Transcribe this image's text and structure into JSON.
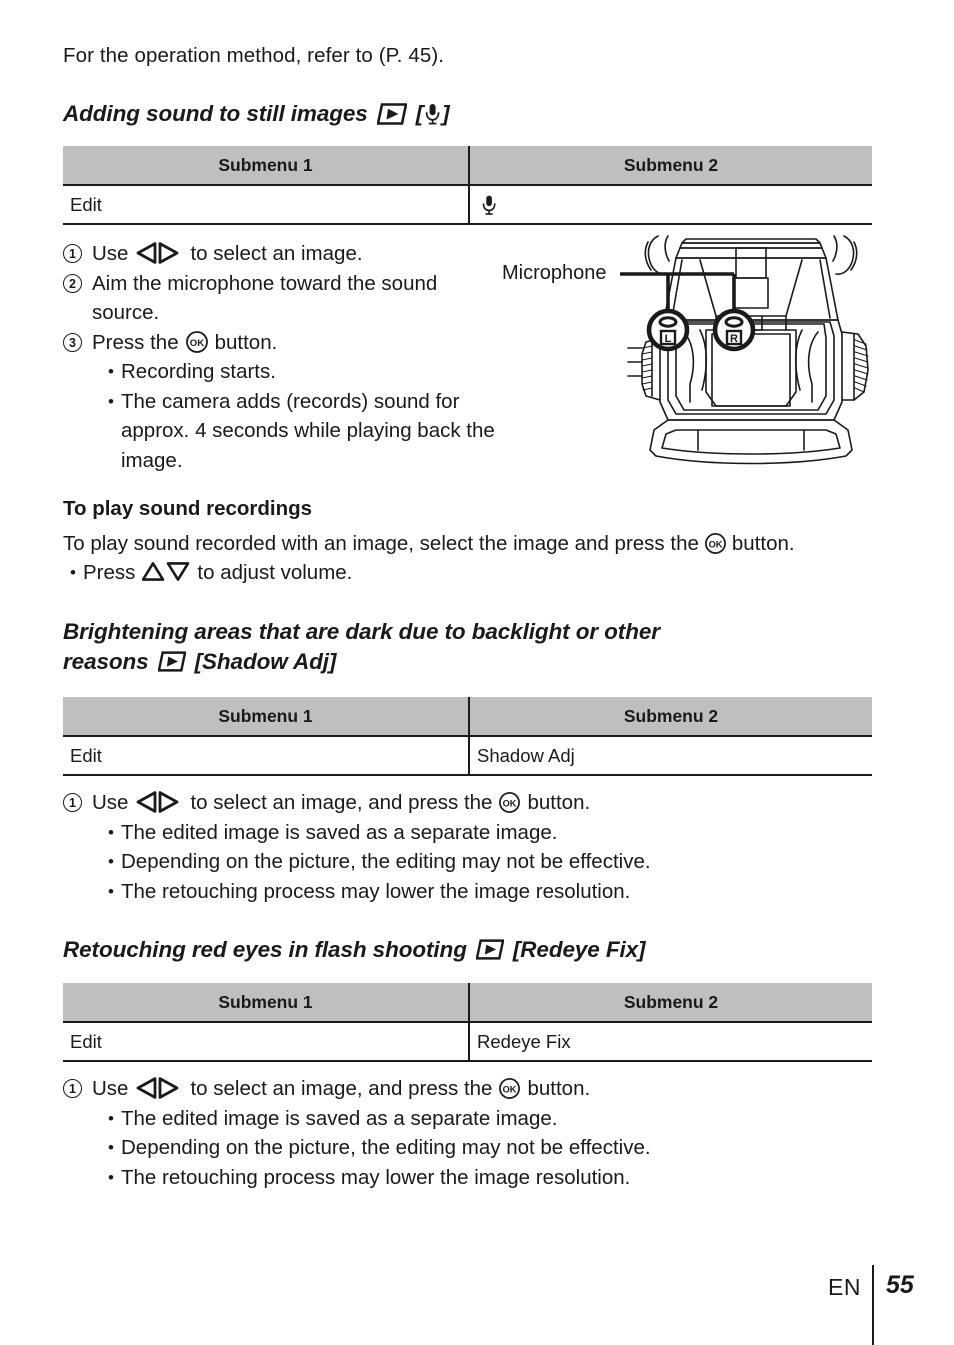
{
  "page": {
    "intro_text": "For the operation method, refer to (P. 45).",
    "footer_lang": "EN",
    "footer_page": "55"
  },
  "colors": {
    "table_header_bg": "#bfbfbf",
    "ink": "#1a1a1a",
    "page_bg": "#ffffff"
  },
  "table_headers": {
    "col1": "Submenu 1",
    "col2": "Submenu 2"
  },
  "sections": [
    {
      "id": "adding-sound",
      "heading_text": "Adding sound to still images",
      "heading_icons": [
        "playback-icon",
        "microphone-icon-bracketed"
      ],
      "heading_bracket_open": "[",
      "heading_bracket_close": "]",
      "table": {
        "row_col1": "Edit",
        "row_col2_icon": "microphone-icon",
        "row_col2": ""
      },
      "steps": [
        {
          "number": "1",
          "text_before": "Use",
          "icon": "left-right-arrows-icon",
          "text_after": "to select an image."
        },
        {
          "number": "2",
          "text_before": "Aim the microphone toward the sound source.",
          "icon": "",
          "text_after": ""
        },
        {
          "number": "3",
          "text_before": "Press the",
          "icon": "ok-button-icon",
          "text_after": "button."
        }
      ],
      "bullets": [
        "Recording starts.",
        "The camera adds (records) sound for approx. 4 seconds while playing back the image."
      ],
      "illustration": {
        "label": "Microphone",
        "mic_left_label": "L",
        "mic_right_label": "R",
        "alt": "camera-top-view-illustration"
      },
      "subsection": {
        "title": "To play sound recordings",
        "paragraph_before": "To play sound recorded with an image, select the image and press the",
        "paragraph_icon": "ok-button-icon",
        "paragraph_after": "button.",
        "bullet_before": "Press",
        "bullet_icon": "up-down-triangles-icon",
        "bullet_after": "to adjust volume."
      }
    },
    {
      "id": "shadow-adj",
      "heading_line1": "Brightening areas that are dark due to backlight or other",
      "heading_line2_before": "reasons",
      "heading_icon": "playback-icon",
      "heading_line2_after": "[Shadow Adj]",
      "table": {
        "row_col1": "Edit",
        "row_col2": "Shadow Adj"
      },
      "step": {
        "number": "1",
        "text_before": "Use",
        "icon_arrows": "left-right-arrows-icon",
        "text_middle": "to select an image, and press the",
        "icon_ok": "ok-button-icon",
        "text_after": "button."
      },
      "bullets": [
        "The edited image is saved as a separate image.",
        "Depending on the picture, the editing may not be effective.",
        "The retouching process may lower the image resolution."
      ]
    },
    {
      "id": "redeye-fix",
      "heading_before": "Retouching red eyes in flash shooting",
      "heading_icon": "playback-icon",
      "heading_after": "[Redeye Fix]",
      "table": {
        "row_col1": "Edit",
        "row_col2": "Redeye Fix"
      },
      "step": {
        "number": "1",
        "text_before": "Use",
        "icon_arrows": "left-right-arrows-icon",
        "text_middle": "to select an image, and press the",
        "icon_ok": "ok-button-icon",
        "text_after": "button."
      },
      "bullets": [
        "The edited image is saved as a separate image.",
        "Depending on the picture, the editing may not be effective.",
        "The retouching process may lower the image resolution."
      ]
    }
  ]
}
